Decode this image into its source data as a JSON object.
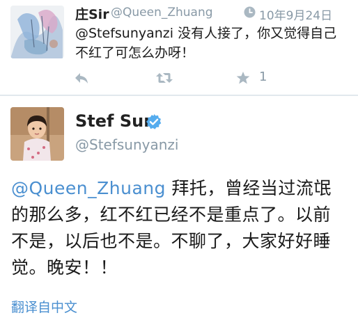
{
  "reply": {
    "name": "庄Sir",
    "handle": "@Queen_Zhuang",
    "time": "10年9月24日",
    "mention": "@Stefsunyanzi",
    "text": " 没有人接了，你又觉得自己不红了可怎么办呀！",
    "favorite_count": "1",
    "icons": {
      "time": "clock-icon",
      "reply": "reply-icon",
      "retweet": "retweet-icon",
      "favorite": "star-icon"
    }
  },
  "tweet": {
    "name": "Stef Sun",
    "handle": "@Stefsunyanzi",
    "mention": "@Queen_Zhuang",
    "text": " 拜托，曾经当过流氓的那么多，红不红已经不是重点了。以前不是，以后也不是。不聊了，大家好好睡觉。晚安！！",
    "translate_label": "翻译自中文",
    "verified_icon": "verified-badge-icon"
  },
  "colors": {
    "link": "#4a8fd0",
    "muted": "#8899a6",
    "verified": "#55acee",
    "divider": "#e1e8ed"
  }
}
